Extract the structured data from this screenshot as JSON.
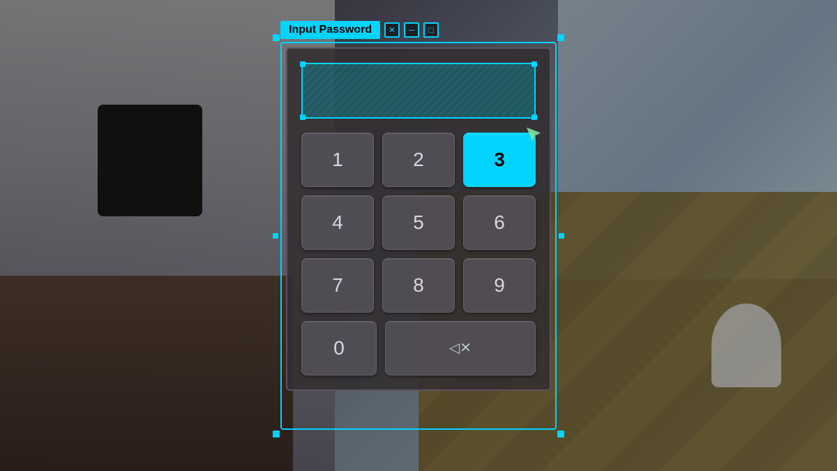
{
  "background": {
    "description": "Game room environment with wooden floor and counter"
  },
  "dialog": {
    "title": "Input Password",
    "title_bar_buttons": {
      "close": "✕",
      "minimize": "─",
      "maximize": "□"
    },
    "display": {
      "placeholder": ""
    },
    "keys": [
      {
        "label": "1",
        "id": "key-1",
        "active": false
      },
      {
        "label": "2",
        "id": "key-2",
        "active": false
      },
      {
        "label": "3",
        "id": "key-3",
        "active": true
      },
      {
        "label": "4",
        "id": "key-4",
        "active": false
      },
      {
        "label": "5",
        "id": "key-5",
        "active": false
      },
      {
        "label": "6",
        "id": "key-6",
        "active": false
      },
      {
        "label": "7",
        "id": "key-7",
        "active": false
      },
      {
        "label": "8",
        "id": "key-8",
        "active": false
      },
      {
        "label": "9",
        "id": "key-9",
        "active": false
      }
    ],
    "key_0": "0",
    "backspace_label": "⌫"
  },
  "colors": {
    "accent": "#00d4ff",
    "panel_bg": "rgba(50,45,48,0.88)",
    "active_key": "#00d4ff",
    "key_bg": "rgba(90,85,95,0.75)"
  }
}
